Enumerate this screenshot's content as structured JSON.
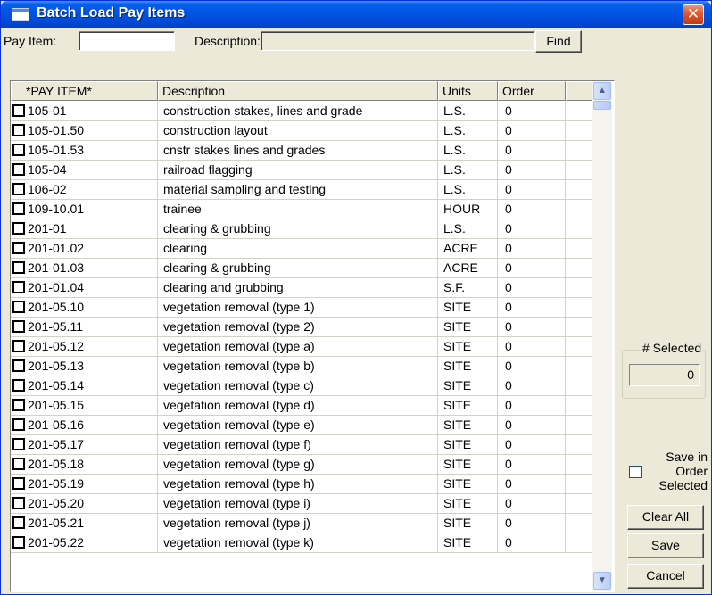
{
  "window": {
    "title": "Batch Load Pay Items",
    "close_glyph": "✕"
  },
  "search": {
    "pay_item_label": "Pay Item:",
    "pay_item_value": "",
    "description_label": "Description:",
    "description_value": "",
    "find_label": "Find"
  },
  "table": {
    "columns": [
      "*PAY ITEM*",
      "Description",
      "Units",
      "Order"
    ],
    "rows": [
      {
        "item": "105-01",
        "description": "construction stakes, lines and grade",
        "units": "L.S.",
        "order": "0"
      },
      {
        "item": "105-01.50",
        "description": "construction layout",
        "units": "L.S.",
        "order": "0"
      },
      {
        "item": "105-01.53",
        "description": "cnstr stakes lines and grades",
        "units": "L.S.",
        "order": "0"
      },
      {
        "item": "105-04",
        "description": "railroad flagging",
        "units": "L.S.",
        "order": "0"
      },
      {
        "item": "106-02",
        "description": "material sampling and testing",
        "units": "L.S.",
        "order": "0"
      },
      {
        "item": "109-10.01",
        "description": "trainee",
        "units": "HOUR",
        "order": "0"
      },
      {
        "item": "201-01",
        "description": "clearing & grubbing",
        "units": "L.S.",
        "order": "0"
      },
      {
        "item": "201-01.02",
        "description": "clearing",
        "units": "ACRE",
        "order": "0"
      },
      {
        "item": "201-01.03",
        "description": "clearing & grubbing",
        "units": "ACRE",
        "order": "0"
      },
      {
        "item": "201-01.04",
        "description": "clearing and grubbing",
        "units": "S.F.",
        "order": "0"
      },
      {
        "item": "201-05.10",
        "description": "vegetation removal (type 1)",
        "units": "SITE",
        "order": "0"
      },
      {
        "item": "201-05.11",
        "description": "vegetation removal (type 2)",
        "units": "SITE",
        "order": "0"
      },
      {
        "item": "201-05.12",
        "description": "vegetation removal (type a)",
        "units": "SITE",
        "order": "0"
      },
      {
        "item": "201-05.13",
        "description": "vegetation removal (type b)",
        "units": "SITE",
        "order": "0"
      },
      {
        "item": "201-05.14",
        "description": "vegetation removal (type c)",
        "units": "SITE",
        "order": "0"
      },
      {
        "item": "201-05.15",
        "description": "vegetation removal (type d)",
        "units": "SITE",
        "order": "0"
      },
      {
        "item": "201-05.16",
        "description": "vegetation removal (type e)",
        "units": "SITE",
        "order": "0"
      },
      {
        "item": "201-05.17",
        "description": "vegetation removal (type f)",
        "units": "SITE",
        "order": "0"
      },
      {
        "item": "201-05.18",
        "description": "vegetation removal (type g)",
        "units": "SITE",
        "order": "0"
      },
      {
        "item": "201-05.19",
        "description": "vegetation removal (type h)",
        "units": "SITE",
        "order": "0"
      },
      {
        "item": "201-05.20",
        "description": "vegetation removal (type i)",
        "units": "SITE",
        "order": "0"
      },
      {
        "item": "201-05.21",
        "description": "vegetation removal (type j)",
        "units": "SITE",
        "order": "0"
      },
      {
        "item": "201-05.22",
        "description": "vegetation removal (type k)",
        "units": "SITE",
        "order": "0"
      }
    ]
  },
  "panel": {
    "selected_label": "# Selected",
    "selected_count": "0",
    "save_in_order_label": "Save in Order Selected",
    "clear_all_label": "Clear All",
    "save_label": "Save",
    "cancel_label": "Cancel"
  },
  "icons": {
    "window": "window-icon",
    "close": "close-icon",
    "row_checkbox": "checkbox-icon",
    "scroll_up": "scroll-up-arrow-icon",
    "scroll_down": "scroll-down-arrow-icon"
  },
  "colors": {
    "titlebar": "#0054e3",
    "close_button": "#e35b2f",
    "dialog_face": "#ece9d8",
    "scrollbar": "#b9cdf7"
  }
}
